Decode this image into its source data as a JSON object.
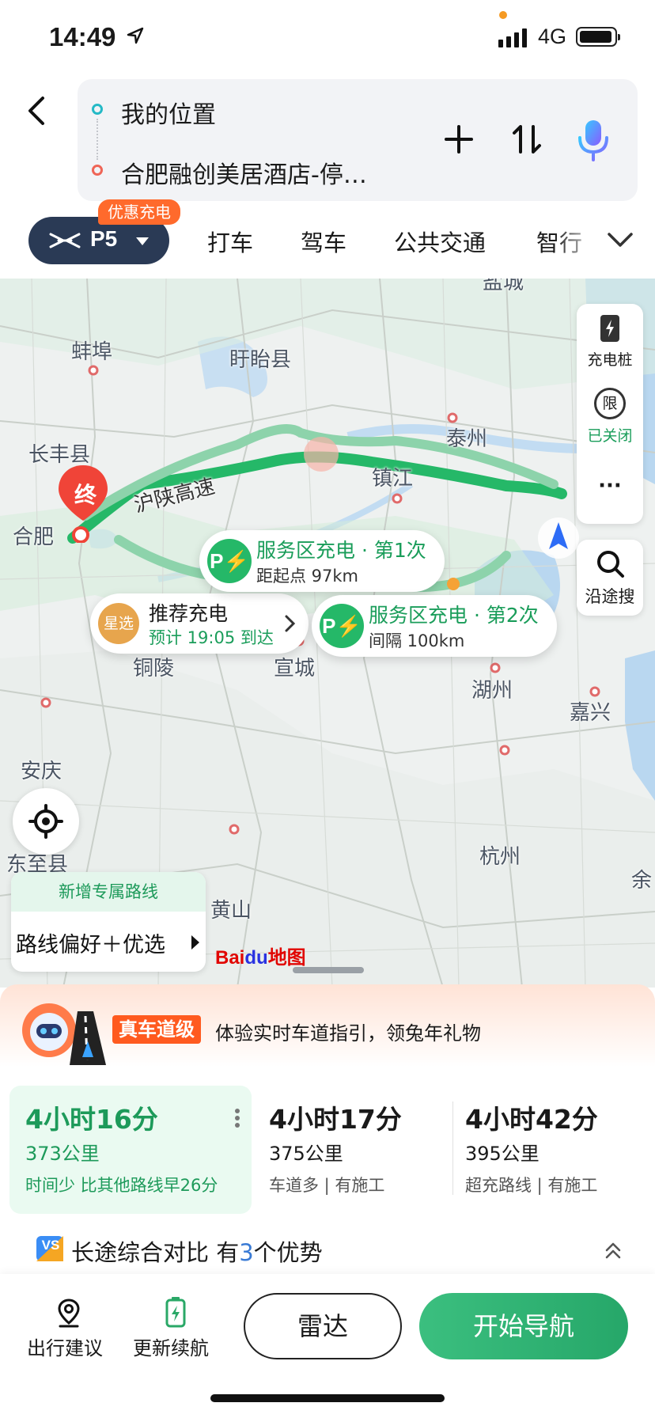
{
  "status_bar": {
    "time": "14:49",
    "network": "4G"
  },
  "route_input": {
    "origin": "我的位置",
    "destination": "合肥融创美居酒店-停…"
  },
  "vehicle": {
    "label": "P5",
    "promo_badge": "优惠充电"
  },
  "mode_tabs": [
    "打车",
    "驾车",
    "公共交通",
    "智行"
  ],
  "map": {
    "cities": [
      "蚌埠",
      "盱眙县",
      "长丰县",
      "泰州",
      "镇江",
      "合肥",
      "铜陵",
      "宣城",
      "湖州",
      "嘉兴",
      "安庆",
      "杭州",
      "东至县",
      "黄山",
      "盐城",
      "余"
    ],
    "highway_label": "沪陕高速",
    "end_marker": "终",
    "charging_recommendation": {
      "badge": "星选",
      "title": "推荐充电",
      "eta": "预计 19:05 到达"
    },
    "charge_stop_1": {
      "title": "服务区充电 · 第1次",
      "detail": "距起点 97km"
    },
    "charge_stop_2": {
      "title": "服务区充电 · 第2次",
      "detail": "间隔 100km"
    },
    "tools": {
      "charging_pile": "充电桩",
      "restriction_icon": "限",
      "restriction_status": "已关闭",
      "more": "···",
      "along_search": "沿途搜"
    },
    "route_pref": {
      "new_tag": "新增专属路线",
      "label": "路线偏好＋优选"
    },
    "logo_bai": "Bai",
    "logo_du": "du",
    "logo_map": "地图"
  },
  "promo": {
    "tag": "真车道级",
    "text": "体验实时车道指引，领兔年礼物"
  },
  "routes": [
    {
      "time": "4小时16分",
      "distance": "373公里",
      "tags": "时间少 比其他路线早26分"
    },
    {
      "time": "4小时17分",
      "distance": "375公里",
      "tags": "车道多 | 有施工"
    },
    {
      "time": "4小时42分",
      "distance": "395公里",
      "tags": "超充路线 | 有施工"
    }
  ],
  "compare": {
    "prefix": "长途综合对比 有",
    "count": "3",
    "suffix": "个优势",
    "icon": "VS"
  },
  "bottom": {
    "advice": "出行建议",
    "update_range": "更新续航",
    "radar": "雷达",
    "start": "开始导航"
  },
  "colors": {
    "route_green": "#25b868",
    "accent_orange": "#ff6a2c",
    "start_button": "#2fb574",
    "end_marker": "#f04438"
  }
}
